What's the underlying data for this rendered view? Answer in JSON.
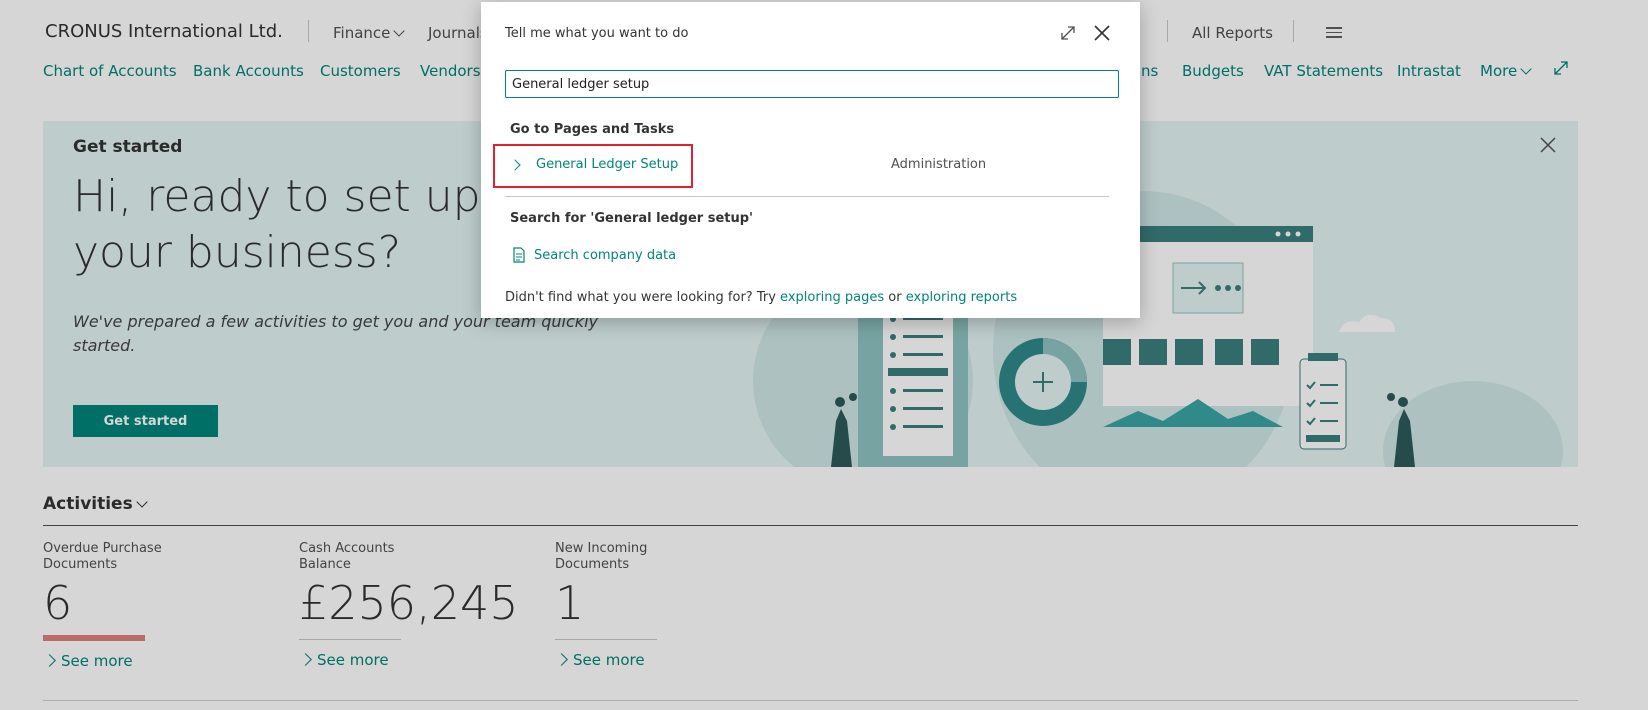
{
  "header": {
    "company": "CRONUS International Ltd.",
    "top_nav": [
      "Finance",
      "Journals",
      "All Reports"
    ]
  },
  "nav_links": [
    "Chart of Accounts",
    "Bank Accounts",
    "Customers",
    "Vendors",
    "ns",
    "Budgets",
    "VAT Statements",
    "Intrastat",
    "More"
  ],
  "banner": {
    "title": "Get started",
    "headline": "Hi, ready to set up your business?",
    "description": "We've prepared a few activities to get you and your team quickly started.",
    "button": "Get started"
  },
  "activities": {
    "title": "Activities",
    "tiles": [
      {
        "label": "Overdue Purchase Documents",
        "value": "6",
        "bar_color": "#e0807c",
        "more": "See more"
      },
      {
        "label": "Cash Accounts Balance",
        "value": "£256,245",
        "bar_color": "#c8c8c8",
        "more": "See more"
      },
      {
        "label": "New Incoming Documents",
        "value": "1",
        "bar_color": "#c8c8c8",
        "more": "See more"
      }
    ]
  },
  "dialog": {
    "title": "Tell me what you want to do",
    "search_value": "General ledger setup",
    "section_pages": "Go to Pages and Tasks",
    "result": {
      "label": "General Ledger Setup",
      "category": "Administration"
    },
    "section_search": "Search for 'General ledger setup'",
    "search_company": "Search company data",
    "footer_prefix": "Didn't find what you were looking for? Try",
    "footer_link1": "exploring pages",
    "footer_or": "or",
    "footer_link2": "exploring reports"
  },
  "colors": {
    "accent": "#00857a",
    "highlight": "#e0232e",
    "banner": "#e3f3f3"
  }
}
